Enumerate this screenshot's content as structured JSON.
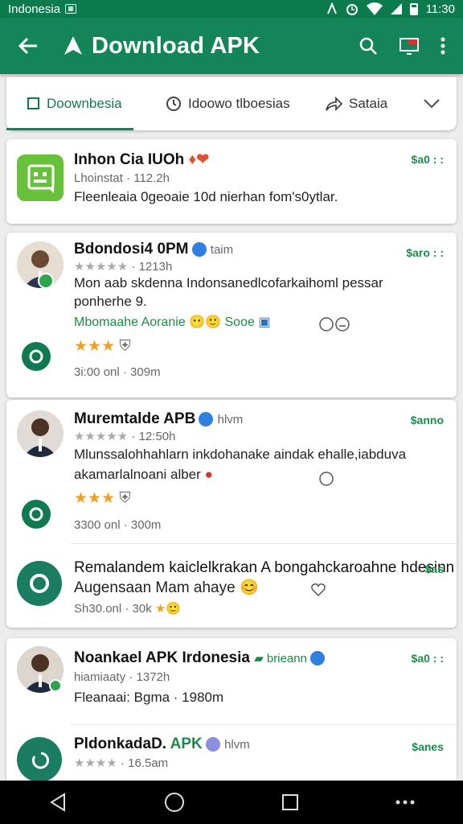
{
  "status": {
    "carrier": "Indonesia",
    "time": "11:30"
  },
  "appbar": {
    "title": "Download APK"
  },
  "tabs": [
    {
      "label": "Doownbesia"
    },
    {
      "label": "Idoowo tlboesias"
    },
    {
      "label": "Sataia"
    }
  ],
  "cards": [
    {
      "name": "Inhon Cia IUOh",
      "meta": "Lhoinstat · 112.2h",
      "line1": "Fleenleaia 0geoaie 10d nierhan fom's0ytlar.",
      "price": "$a0 : :"
    },
    {
      "name": "Bdondosi4 0PM",
      "tag": "taim",
      "meta": "1213h",
      "line1": "Mon aab skdenna Indonsanedlcofarkaihoml pessar",
      "line2": "ponherhe 9.",
      "line3": "Mbomaahe Aoranie",
      "line3b": "Sooe",
      "price": "$aro : :",
      "meta2": "3i:00 onl · 309m"
    },
    {
      "name": "Muremtalde APB",
      "tag": "hlvm",
      "meta": "12:50h",
      "line1": "Mlunssalohhahlarn inkdohanake aindak ehalle,iabduva",
      "line2": "akamarlalnoani alber",
      "price": "$anno",
      "meta2": "3300 onl · 300m",
      "r_line1": "Remalandem kaiclelkrakan A bongahckaroahne hdesinn",
      "r_line2": "Augensaan Mam ahaye",
      "r_meta": "Sh30.onl · 30k",
      "r_price": "$as"
    },
    {
      "name": "Noankael APK Irdonesia",
      "tag": "brieann",
      "meta": "hiamiaaty · 1372h",
      "line1": "Fleanaai: Bgma · 1980m",
      "price": "$a0 : :",
      "sub_name": "PldonkadaD.",
      "sub_name2": "APK",
      "sub_tag": "hlvm",
      "sub_meta": "16.5am",
      "sub_price": "$anes"
    }
  ]
}
